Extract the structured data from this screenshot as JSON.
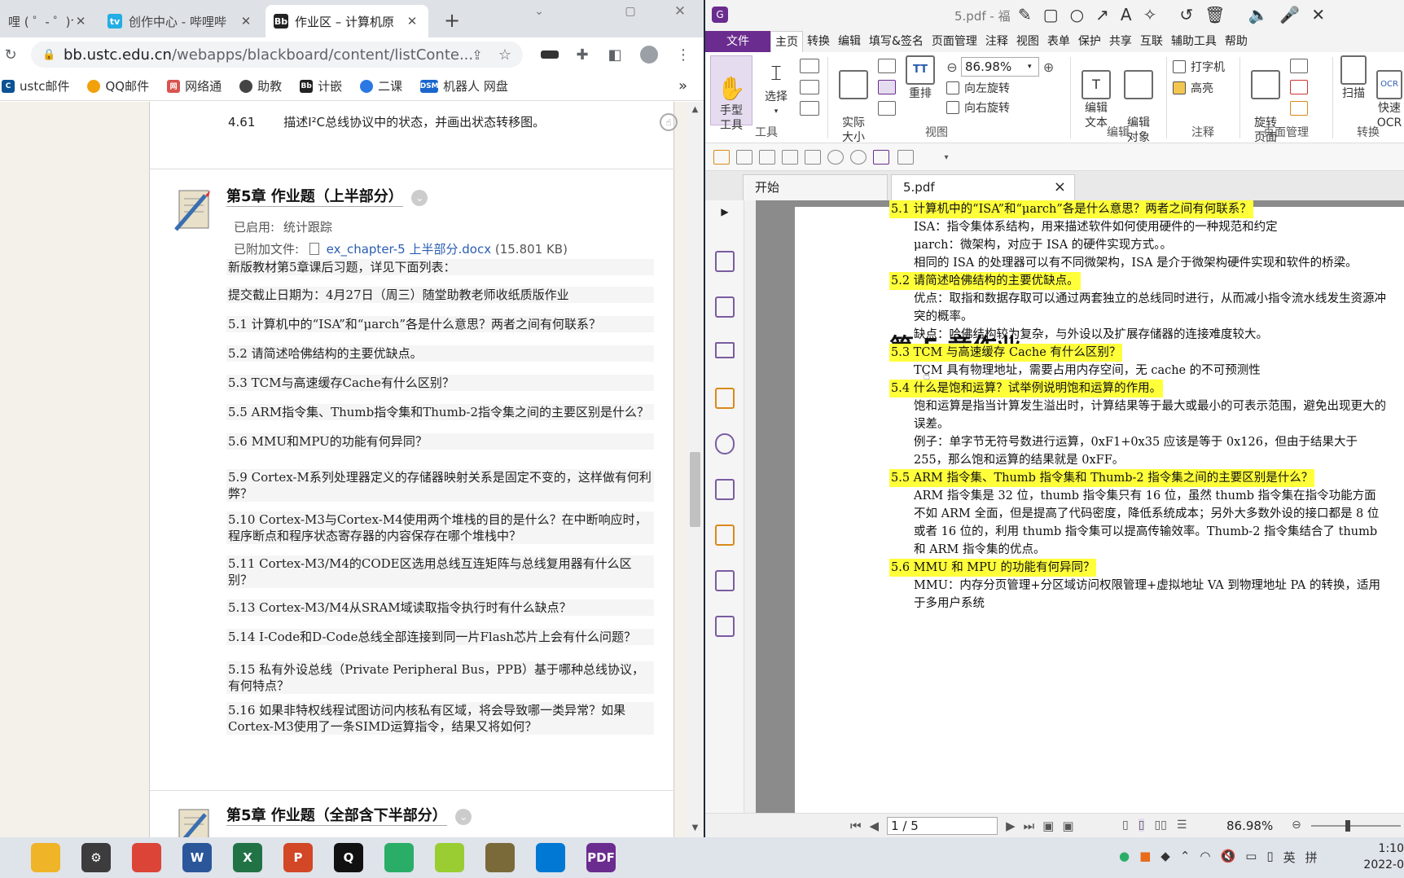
{
  "browser": {
    "tabs": [
      {
        "title": "哩 ( ゜- ゜)つ",
        "active": false
      },
      {
        "title": "创作中心 - 哔哩哔",
        "active": false
      },
      {
        "title": "作业区 – 计算机原",
        "active": true
      }
    ],
    "new_tab": "+",
    "url_host": "bb.ustc.edu.cn",
    "url_path": "/webapps/blackboard/content/listConte...",
    "bookmarks": [
      {
        "label": "ustc邮件",
        "color": "#0b5394"
      },
      {
        "label": "QQ邮件",
        "color": "#f2a10b"
      },
      {
        "label": "网络通",
        "color": "#d9534f"
      },
      {
        "label": "助教",
        "color": "#444444"
      },
      {
        "label": "计嵌",
        "color": "#222222"
      },
      {
        "label": "二课",
        "color": "#2b78e4"
      },
      {
        "label": "机器人 网盘",
        "color": "#1a66cc"
      }
    ],
    "bookmarks_more": "»"
  },
  "content": {
    "top_item": {
      "num": "4.61",
      "text": "描述I²C总线协议中的状态，并画出状态转移图。"
    },
    "item1": {
      "title": "第5章 作业题（上半部分）",
      "enabled_label": "已启用:",
      "enabled_value": "统计跟踪",
      "attach_label": "已附加文件:",
      "attach_file": "ex_chapter-5 上半部分.docx",
      "attach_size": "(15.801 KB)",
      "lines": [
        "新版教材第5章课后习题，详见下面列表：",
        "提交截止日期为：4月27日（周三）随堂助教老师收纸质版作业",
        "5.1 计算机中的“ISA”和“μarch”各是什么意思？两者之间有何联系？",
        "5.2 请简述哈佛结构的主要优缺点。",
        "5.3 TCM与高速缓存Cache有什么区别？",
        "5.5 ARM指令集、Thumb指令集和Thumb-2指令集之间的主要区别是什么？",
        "5.6 MMU和MPU的功能有何异同？",
        "5.9 Cortex-M系列处理器定义的存储器映射关系是固定不变的，这样做有何利弊？",
        "5.10 Cortex-M3与Cortex-M4使用两个堆栈的目的是什么？在中断响应时，程序断点和程序状态寄存器的内容保存在哪个堆栈中？",
        "5.11 Cortex-M3/M4的CODE区选用总线互连矩阵与总线复用器有什么区别？",
        "5.13 Cortex-M3/M4从SRAM域读取指令执行时有什么缺点？",
        "5.14 I-Code和D-Code总线全部连接到同一片Flash芯片上会有什么问题？",
        "5.15 私有外设总线（Private Peripheral Bus，PPB）基于哪种总线协议，有何特点？",
        "5.16 如果非特权线程试图访问内核私有区域，将会导致哪一类异常？如果Cortex-M3使用了一条SIMD运算指令，结果又将如何？"
      ]
    },
    "item2": {
      "title": "第5章 作业题（全部含下半部分）"
    }
  },
  "pdf": {
    "title": "5.pdf - 福",
    "menus": [
      "文件",
      "主页",
      "转换",
      "编辑",
      "填写&签名",
      "页面管理",
      "注释",
      "视图",
      "表单",
      "保护",
      "共享",
      "互联",
      "辅助工具",
      "帮助"
    ],
    "ribbon": {
      "hand": "手型\n工具",
      "select": "选择",
      "actual": "实际\n大小",
      "reflow": "重排",
      "zoom": "86.98%",
      "rotate_left": "向左旋转",
      "rotate_right": "向右旋转",
      "edit_text": "编辑\n文本",
      "edit_obj": "编辑\n对象",
      "typewriter": "打字机",
      "highlight": "高亮",
      "rotate_page": "旋转\n页面",
      "scan": "扫描",
      "ocr": "快速\nOCR",
      "groups": [
        "工具",
        "视图",
        "编辑",
        "注释",
        "页面管理",
        "转换"
      ]
    },
    "doc_tabs": [
      {
        "label": "开始"
      },
      {
        "label": "5.pdf",
        "close": "×"
      }
    ],
    "page": {
      "heading": "第 5 章作业",
      "lines": [
        {
          "q": true,
          "text": "5.1  计算机中的“ISA”和“μarch”各是什么意思？两者之间有何联系？"
        },
        {
          "q": false,
          "text": "ISA：指令集体系结构，用来描述软件如何使用硬件的一种规范和约定"
        },
        {
          "q": false,
          "text": "μarch：微架构，对应于 ISA 的硬件实现方式。。"
        },
        {
          "q": false,
          "text": "相同的 ISA 的处理器可以有不同微架构，ISA 是介于微架构硬件实现和软件的桥梁。"
        },
        {
          "q": true,
          "text": "5.2  请简述哈佛结构的主要优缺点。"
        },
        {
          "q": false,
          "text": "优点：取指和数据存取可以通过两套独立的总线同时进行，从而减小指令流水线发生资源冲突的概率。"
        },
        {
          "q": false,
          "text": "缺点：哈佛结构较为复杂，与外设以及扩展存储器的连接难度较大。"
        },
        {
          "q": true,
          "text": "5.3 TCM 与高速缓存 Cache 有什么区别？"
        },
        {
          "q": false,
          "text": "TCM 具有物理地址，需要占用内存空间，无 cache 的不可预测性"
        },
        {
          "q": true,
          "text": "5.4  什么是饱和运算？试举例说明饱和运算的作用。"
        },
        {
          "q": false,
          "text": "饱和运算是指当计算发生溢出时，计算结果等于最大或最小的可表示范围，避免出现更大的误差。"
        },
        {
          "q": false,
          "text": "例子：单字节无符号数进行运算，0xF1+0x35 应该是等于 0x126，但由于结果大于 255，那么饱和运算的结果就是 0xFF。"
        },
        {
          "q": true,
          "text": "5.5 ARM 指令集、Thumb 指令集和 Thumb-2 指令集之间的主要区别是什么？"
        },
        {
          "q": false,
          "text": "ARM 指令集是 32 位，thumb 指令集只有 16 位，虽然 thumb 指令集在指令功能方面不如 ARM 全面，但是提高了代码密度，降低系统成本；另外大多数外设的接口都是 8 位或者 16 位的，利用 thumb 指令集可以提高传输效率。Thumb-2 指令集结合了 thumb 和 ARM 指令集的优点。"
        },
        {
          "q": true,
          "text": "5.6 MMU 和 MPU 的功能有何异同？"
        },
        {
          "q": false,
          "text": "MMU：内存分页管理+分区域访问权限管理+虚拟地址 VA 到物理地址 PA 的转换，适用于多用户系统"
        }
      ]
    },
    "status": {
      "page": "1 / 5",
      "zoom": "86.98%"
    }
  },
  "taskbar": {
    "apps": [
      {
        "name": "file-explorer",
        "glyph": "",
        "color": "#f0b429"
      },
      {
        "name": "settings",
        "glyph": "⚙",
        "color": "#3c3c3c"
      },
      {
        "name": "chrome",
        "glyph": "",
        "color": "#db4437"
      },
      {
        "name": "word",
        "glyph": "W",
        "color": "#2b579a"
      },
      {
        "name": "excel",
        "glyph": "X",
        "color": "#217346"
      },
      {
        "name": "powerpoint",
        "glyph": "P",
        "color": "#d24726"
      },
      {
        "name": "qq",
        "glyph": "Q",
        "color": "#111111"
      },
      {
        "name": "wechat",
        "glyph": "",
        "color": "#2aae67"
      },
      {
        "name": "app-yellow",
        "glyph": "",
        "color": "#9acd32"
      },
      {
        "name": "app-box",
        "glyph": "",
        "color": "#7a6a3a"
      },
      {
        "name": "vscode",
        "glyph": "",
        "color": "#0078d4"
      },
      {
        "name": "foxit-pdf",
        "glyph": "PDF",
        "color": "#6b2c8f"
      }
    ],
    "tray_lang": "英",
    "tray_ime": "拼",
    "time": "1:10",
    "date": "2022-0"
  }
}
